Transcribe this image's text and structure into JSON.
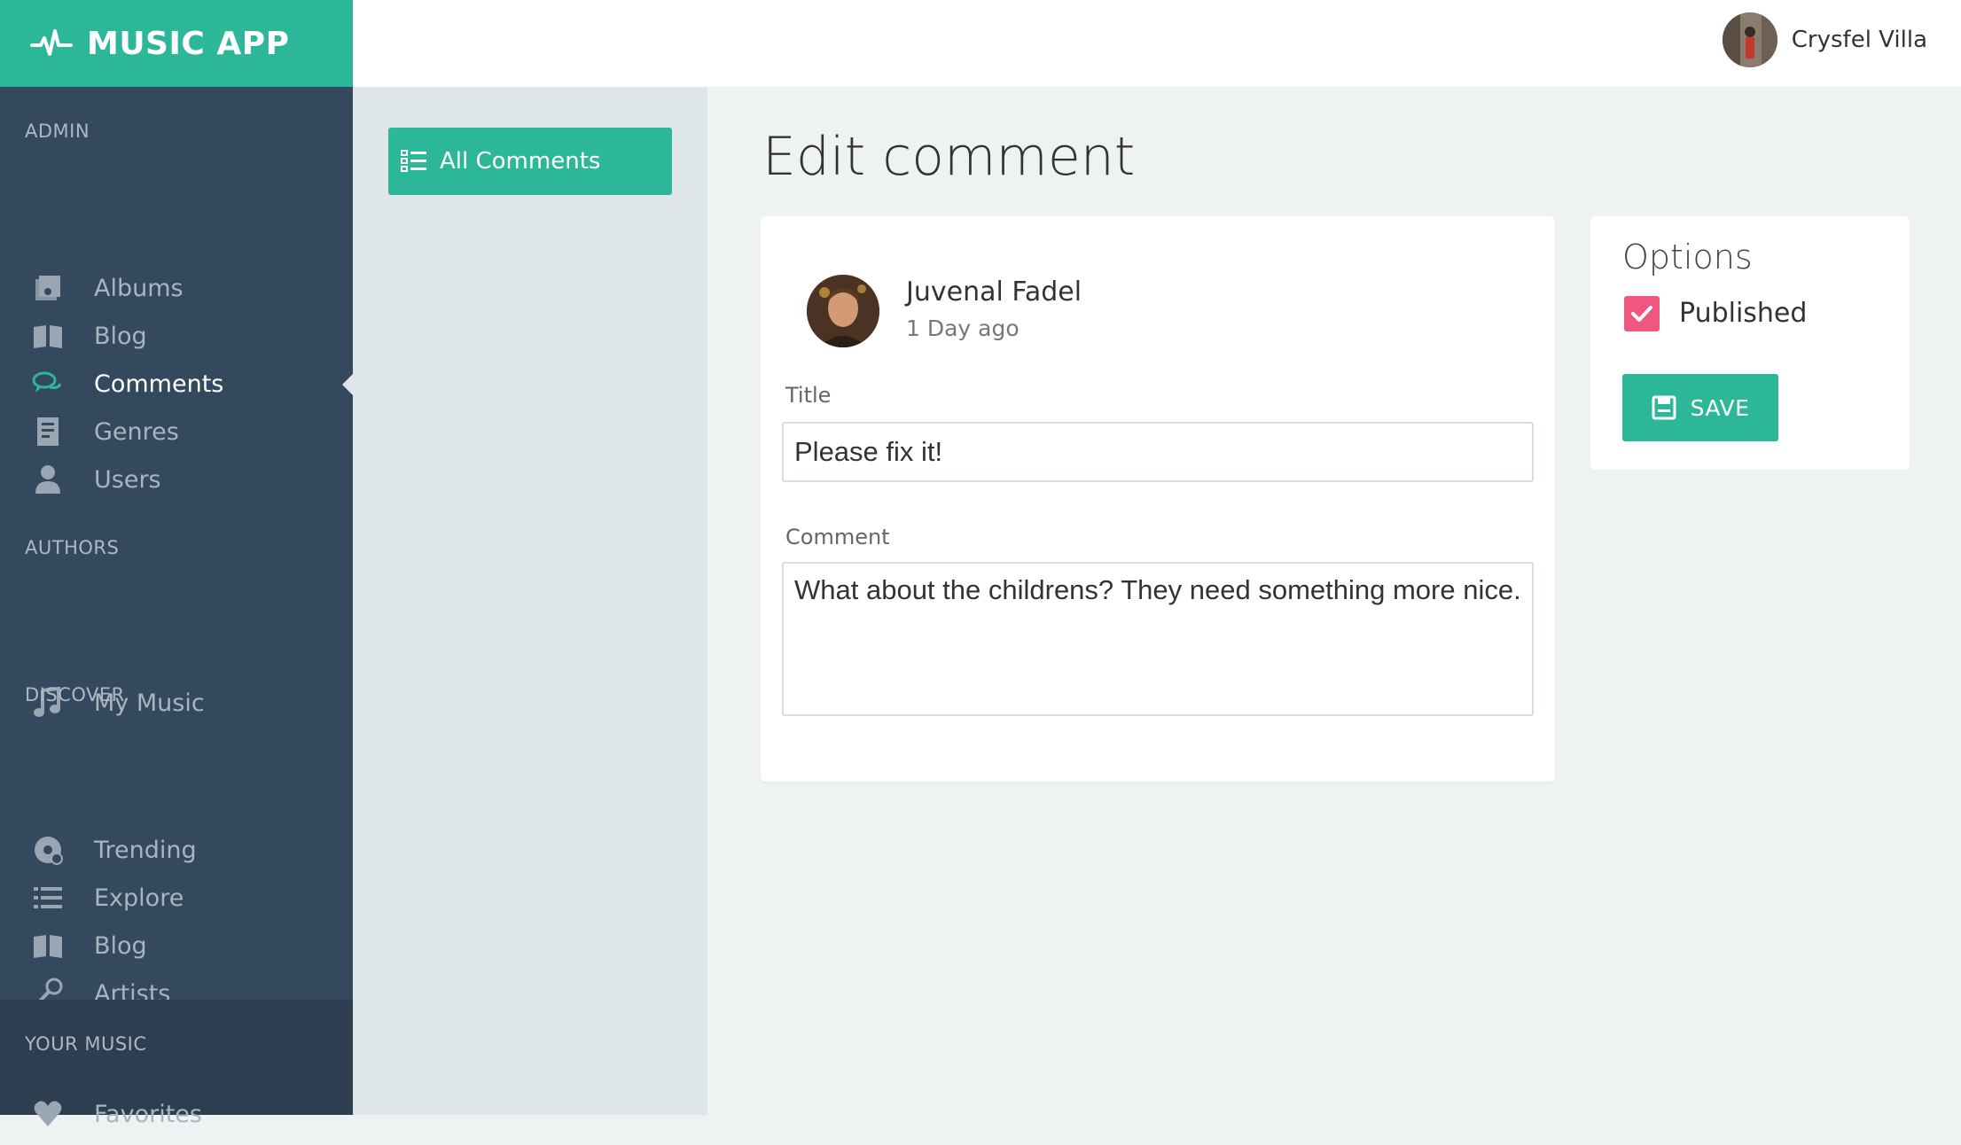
{
  "app": {
    "title": "MUSIC APP",
    "brand_icon": "pulse-icon"
  },
  "header": {
    "user_name": "Crysfel Villa"
  },
  "sidebar": {
    "sections": [
      {
        "label": "ADMIN"
      },
      {
        "label": "AUTHORS"
      },
      {
        "label": "DISCOVER"
      },
      {
        "label": "YOUR MUSIC"
      }
    ],
    "items": [
      {
        "label": "Albums",
        "icon": "album-icon"
      },
      {
        "label": "Blog",
        "icon": "book-icon"
      },
      {
        "label": "Comments",
        "icon": "comments-icon",
        "active": true
      },
      {
        "label": "Genres",
        "icon": "document-icon"
      },
      {
        "label": "Users",
        "icon": "user-icon"
      },
      {
        "label": "My Music",
        "icon": "music-note-icon"
      },
      {
        "label": "Trending",
        "icon": "disc-icon"
      },
      {
        "label": "Explore",
        "icon": "list-icon"
      },
      {
        "label": "Blog",
        "icon": "book-icon"
      },
      {
        "label": "Artists",
        "icon": "microphone-icon"
      },
      {
        "label": "Favorites",
        "icon": "heart-icon"
      }
    ]
  },
  "subnav": {
    "all_comments_label": "All Comments"
  },
  "main": {
    "page_title": "Edit comment",
    "comment": {
      "author": "Juvenal Fadel",
      "time": "1 Day ago",
      "title_label": "Title",
      "title_value": "Please fix it!",
      "comment_label": "Comment",
      "comment_value": "What about the childrens? They need something more nice."
    },
    "options": {
      "title": "Options",
      "published_label": "Published",
      "published": true,
      "save_label": "SAVE"
    }
  },
  "colors": {
    "accent": "#2cb799",
    "sidebar": "#34495e",
    "checkbox": "#f0567f"
  }
}
